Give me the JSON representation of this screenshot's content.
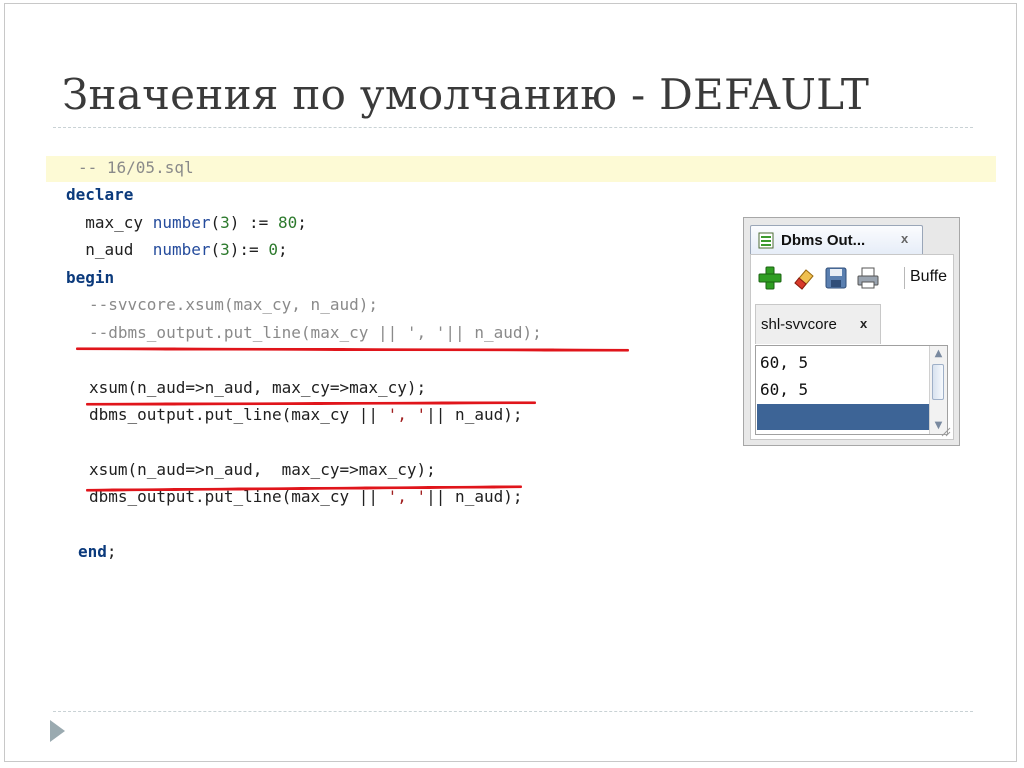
{
  "slide": {
    "title": "Значения по умолчанию - DEFAULT"
  },
  "code": {
    "line1": "-- 16/05.sql",
    "declare_kw": "declare",
    "l3_var": "  max_cy ",
    "l3_type": "number",
    "l3_open": "(",
    "l3_num": "3",
    "l3_mid": ") := ",
    "l3_val": "80",
    "l3_end": ";",
    "l4_var": "  n_aud  ",
    "l4_type": "number",
    "l4_open": "(",
    "l4_num": "3",
    "l4_mid": "):= ",
    "l4_val": "0",
    "l4_end": ";",
    "begin_kw": "begin",
    "comment1": "--svvcore.xsum(max_cy, n_aud);",
    "comment2": "--dbms_output.put_line(max_cy || ', '|| n_aud);",
    "call1": "xsum(n_aud=>n_aud, max_cy=>max_cy);",
    "put1_a": "dbms_output.put_line(max_cy || ",
    "put1_s": "', '",
    "put1_b": "|| n_aud);",
    "call2": "xsum(n_aud=>n_aud,  max_cy=>max_cy);",
    "put2_a": "dbms_output.put_line(max_cy || ",
    "put2_s": "', '",
    "put2_b": "|| n_aud);",
    "end_kw": "end",
    "end_semi": ";"
  },
  "dbms_panel": {
    "tab_label": "Dbms Out...",
    "tab_close": "x",
    "buffer_label": "Buffe",
    "connection_tab": "shl-svvcore",
    "connection_close": "x",
    "output_lines": [
      "60, 5",
      "60, 5"
    ]
  },
  "colors": {
    "highlight_line": "#fdfad5",
    "keyword": "#0b3a7c",
    "annotation_underline": "#e0151b",
    "selection": "#3d6496"
  }
}
